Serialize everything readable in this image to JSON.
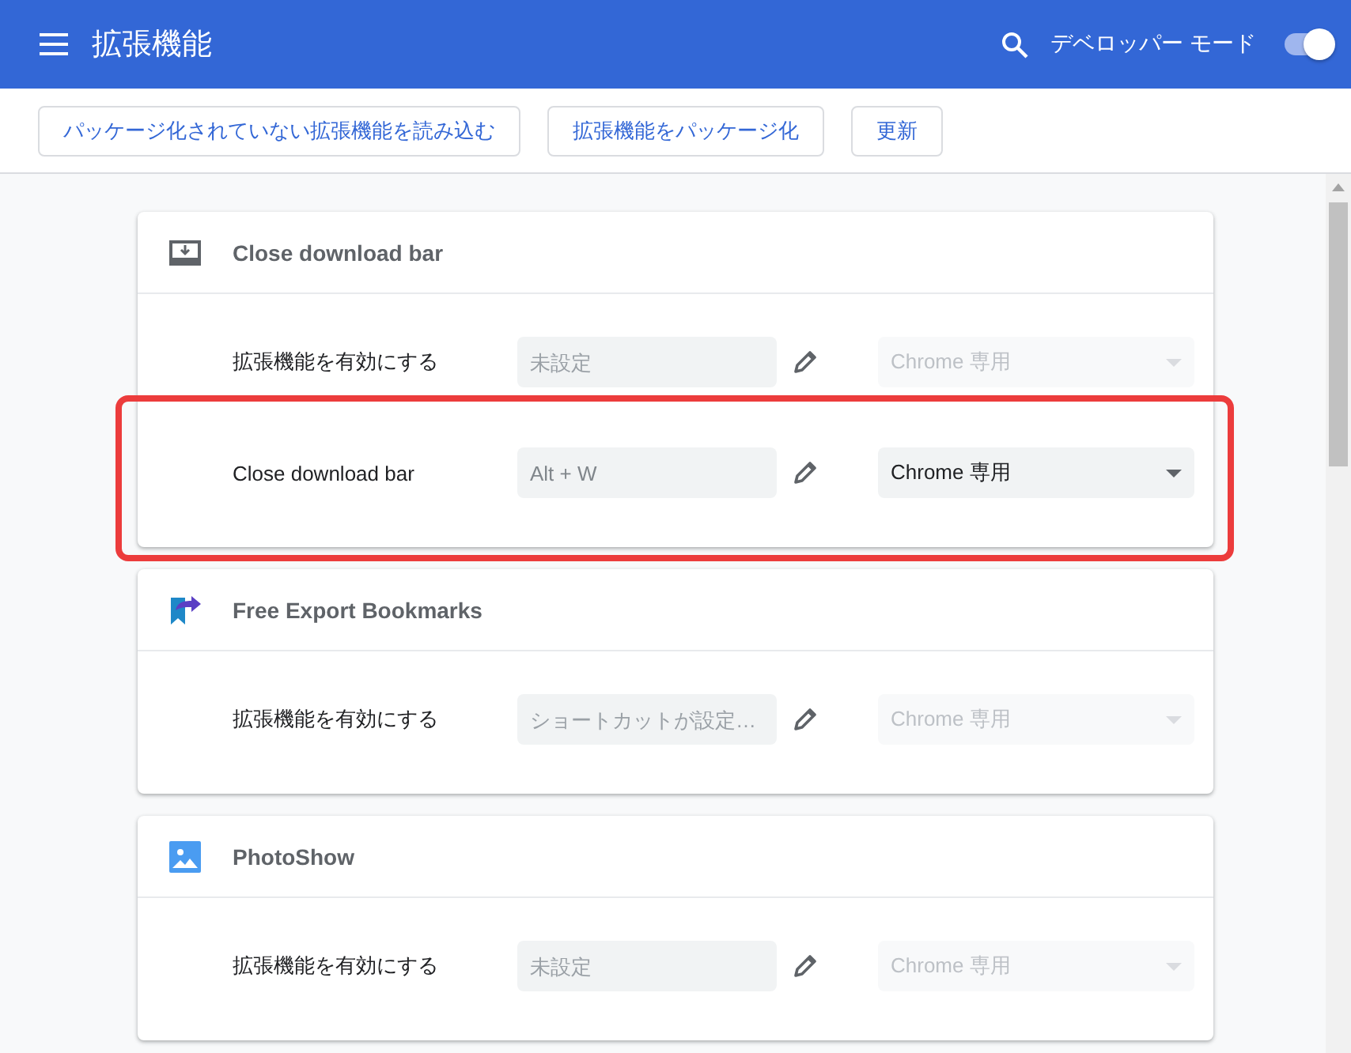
{
  "header": {
    "title": "拡張機能",
    "developer_mode": {
      "label": "デベロッパー モード",
      "on": true
    }
  },
  "toolbar": {
    "buttons": [
      "パッケージ化されていない拡張機能を読み込む",
      "拡張機能をパッケージ化",
      "更新"
    ]
  },
  "extensions": [
    {
      "name": "Close download bar",
      "commands": [
        {
          "label": "拡張機能を有効にする",
          "shortcut": {
            "placeholder": "未設定"
          },
          "scope": {
            "label": "Chrome 専用",
            "disabled": true
          },
          "highlighted": false
        },
        {
          "label": "Close download bar",
          "shortcut": {
            "value": "Alt + W"
          },
          "scope": {
            "label": "Chrome 専用",
            "disabled": false
          },
          "highlighted": true
        }
      ]
    },
    {
      "name": "Free Export Bookmarks",
      "commands": [
        {
          "label": "拡張機能を有効にする",
          "shortcut": {
            "placeholder": "ショートカットが設定…"
          },
          "scope": {
            "label": "Chrome 専用",
            "disabled": true
          },
          "highlighted": false
        }
      ]
    },
    {
      "name": "PhotoShow",
      "commands": [
        {
          "label": "拡張機能を有効にする",
          "shortcut": {
            "placeholder": "未設定"
          },
          "scope": {
            "label": "Chrome 専用",
            "disabled": true
          },
          "highlighted": false
        }
      ]
    }
  ]
}
